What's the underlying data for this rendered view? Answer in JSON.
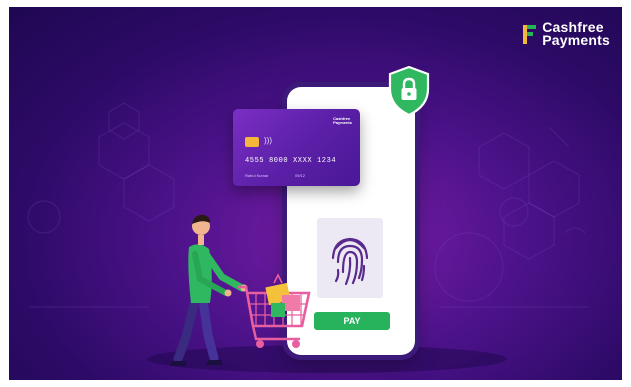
{
  "brand": {
    "name_line1": "Cashfree",
    "name_line2": "Payments",
    "accent": "#f4b73b",
    "accent2": "#27b35c"
  },
  "card": {
    "brand_line1": "Cashfree",
    "brand_line2": "Payments",
    "number": "4555 8000 XXXX 1234",
    "holder": "Rahul Kumar",
    "expiry": "09/12",
    "chip_icon": "card-chip-icon",
    "contactless_icon": "contactless-icon"
  },
  "phone": {
    "biometric_icon": "fingerprint-icon",
    "pay_label": "PAY",
    "pay_color": "#27b35c"
  },
  "security": {
    "icon": "shield-lock-icon",
    "color": "#2fb85f"
  },
  "colors": {
    "background": "#3a0f78",
    "highlight": "#7b1ea8"
  }
}
